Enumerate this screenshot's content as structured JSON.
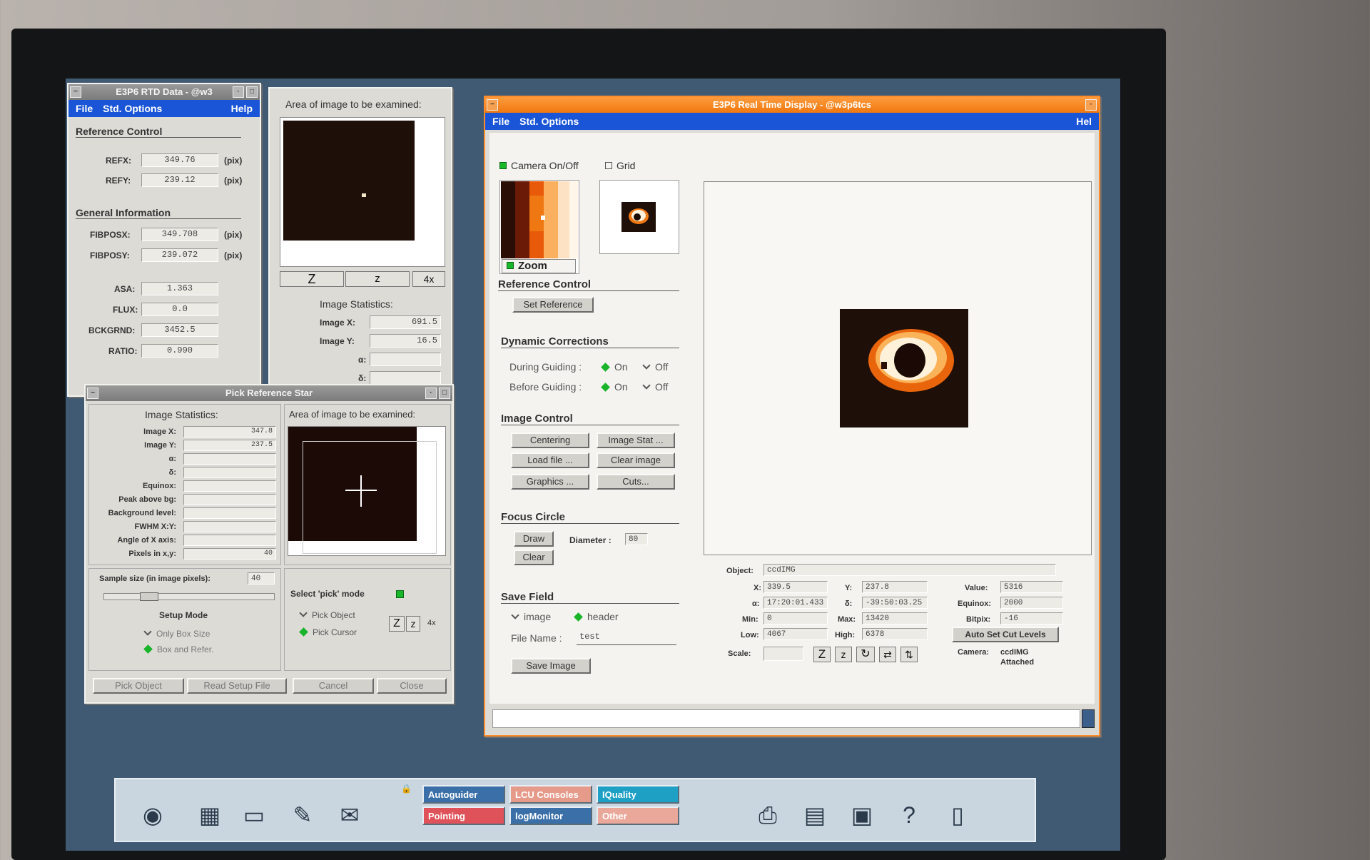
{
  "rtd_data": {
    "title": "E3P6 RTD Data - @w3",
    "menu": [
      "File",
      "Std. Options",
      "Help"
    ],
    "reference_control": {
      "heading": "Reference Control",
      "refx_label": "REFX:",
      "refx": "349.76",
      "refy_label": "REFY:",
      "refy": "239.12",
      "unit": "(pix)"
    },
    "general_info": {
      "heading": "General Information",
      "fibposx_label": "FIBPOSX:",
      "fibposx": "349.708",
      "fibposy_label": "FIBPOSY:",
      "fibposy": "239.072",
      "unit": "(pix)",
      "asa_label": "ASA:",
      "asa": "1.363",
      "flux_label": "FLUX:",
      "flux": "0.0",
      "bckgrnd_label": "BCKGRND:",
      "bckgrnd": "3452.5",
      "ratio_label": "RATIO:",
      "ratio": "0.990"
    }
  },
  "area_panel": {
    "title": "Area of image to be examined:",
    "zoom_buttons": [
      "Z",
      "z",
      "4x"
    ],
    "stats_heading": "Image Statistics:",
    "image_x_label": "Image X:",
    "image_x": "691.5",
    "image_y_label": "Image Y:",
    "image_y": "16.5",
    "alpha_label": "α:",
    "delta_label": "δ:"
  },
  "pick_star": {
    "title": "Pick Reference Star",
    "stats_heading": "Image Statistics:",
    "area_heading": "Area of image to be examined:",
    "rows": [
      {
        "label": "Image X:",
        "value": "347.8"
      },
      {
        "label": "Image Y:",
        "value": "237.5"
      },
      {
        "label": "α:",
        "value": ""
      },
      {
        "label": "δ:",
        "value": ""
      },
      {
        "label": "Equinox:",
        "value": ""
      },
      {
        "label": "Peak above bg:",
        "value": ""
      },
      {
        "label": "Background level:",
        "value": ""
      },
      {
        "label": "FWHM X:Y:",
        "value": ""
      },
      {
        "label": "Angle of X axis:",
        "value": ""
      },
      {
        "label": "Pixels in x,y:",
        "value": "40"
      }
    ],
    "sample_size_label": "Sample size (in image pixels):",
    "sample_size": "40",
    "setup_mode_heading": "Setup Mode",
    "setup_option_1": "Only Box Size",
    "setup_option_2": "Box and Refer.",
    "select_pick_mode": "Select 'pick' mode",
    "pick_object_option": "Pick Object",
    "pick_cursor_option": "Pick Cursor",
    "zoom_buttons": [
      "Z",
      "z",
      "4x"
    ],
    "buttons": [
      "Pick Object",
      "Read Setup File",
      "Cancel",
      "Close"
    ]
  },
  "rtd": {
    "title": "E3P6 Real Time Display - @w3p6tcs",
    "menu": [
      "File",
      "Std. Options",
      "Hel"
    ],
    "camera_toggle": "Camera On/Off",
    "grid_toggle": "Grid",
    "zoom_label": "Zoom",
    "reference_control_heading": "Reference Control",
    "set_reference": "Set Reference",
    "dynamic_corrections_heading": "Dynamic Corrections",
    "during_guiding": "During Guiding :",
    "before_guiding": "Before Guiding :",
    "on_label": "On",
    "off_label": "Off",
    "image_control_heading": "Image Control",
    "image_control_buttons": [
      "Centering",
      "Image Stat ...",
      "Load file ...",
      "Clear image",
      "Graphics ...",
      "Cuts..."
    ],
    "focus_circle_heading": "Focus Circle",
    "draw_button": "Draw",
    "clear_button": "Clear",
    "diameter_label": "Diameter :",
    "diameter": "80",
    "save_field_heading": "Save Field",
    "save_image_option": "image",
    "save_header_option": "header",
    "file_name_label": "File Name :",
    "file_name": "test",
    "save_image_button": "Save Image",
    "info": {
      "object_label": "Object:",
      "object": "ccdIMG",
      "x_label": "X:",
      "x": "339.5",
      "y_label": "Y:",
      "y": "237.8",
      "value_label": "Value:",
      "value": "5316",
      "alpha_label": "α:",
      "alpha": "17:20:01.433",
      "delta_label": "δ:",
      "delta": "-39:50:03.25",
      "equinox_label": "Equinox:",
      "equinox": "2000",
      "min_label": "Min:",
      "min": "0",
      "max_label": "Max:",
      "max": "13420",
      "bitpix_label": "Bitpix:",
      "bitpix": "-16",
      "low_label": "Low:",
      "low": "4067",
      "high_label": "High:",
      "high": "6378",
      "auto_set_cut_levels": "Auto Set Cut Levels",
      "scale_label": "Scale:",
      "camera_label": "Camera:",
      "camera": "ccdIMG",
      "camera_status": "Attached"
    }
  },
  "taskbar": {
    "tiles": [
      {
        "label": "Autoguider",
        "color": "#3a6fa8"
      },
      {
        "label": "LCU Consoles",
        "color": "#e59a8a"
      },
      {
        "label": "IQuality",
        "color": "#1e9fc4"
      },
      {
        "label": "Pointing",
        "color": "#e0525a"
      },
      {
        "label": "logMonitor",
        "color": "#3a6fa8"
      },
      {
        "label": "Other",
        "color": "#e9a89a"
      }
    ]
  }
}
